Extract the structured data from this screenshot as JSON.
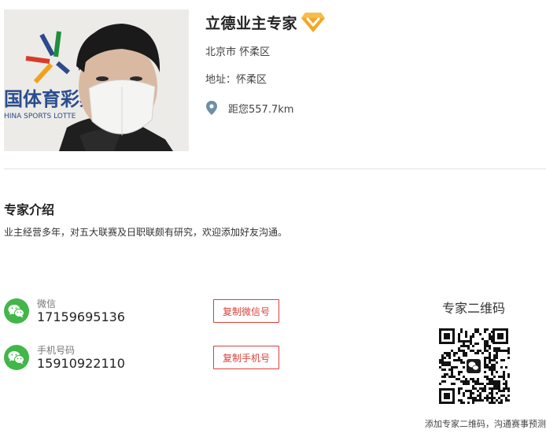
{
  "expert": {
    "name": "立德业主专家",
    "badge_icon": "vip-diamond-icon",
    "city": "北京市 怀柔区",
    "address": "地址：怀柔区",
    "distance": "距您557.7km",
    "photo_bg_text": "国体育彩票",
    "photo_bg_text_en": "HINA SPORTS LOTTE"
  },
  "intro": {
    "title": "专家介绍",
    "text": "业主经营多年，对五大联赛及日职联颇有研究，欢迎添加好友沟通。"
  },
  "contacts": {
    "wechat": {
      "label": "微信",
      "value": "17159695136",
      "button": "复制微信号",
      "icon": "wechat-icon"
    },
    "phone": {
      "label": "手机号码",
      "value": "15910922110",
      "button": "复制手机号",
      "icon": "wechat-icon"
    }
  },
  "qr": {
    "title": "专家二维码",
    "caption": "添加专家二维码，沟通赛事预测"
  },
  "colors": {
    "accent_red": "#d9413a",
    "wechat_green": "#43b649",
    "badge_orange": "#f5a623",
    "pin_blue": "#6e8fa8"
  }
}
